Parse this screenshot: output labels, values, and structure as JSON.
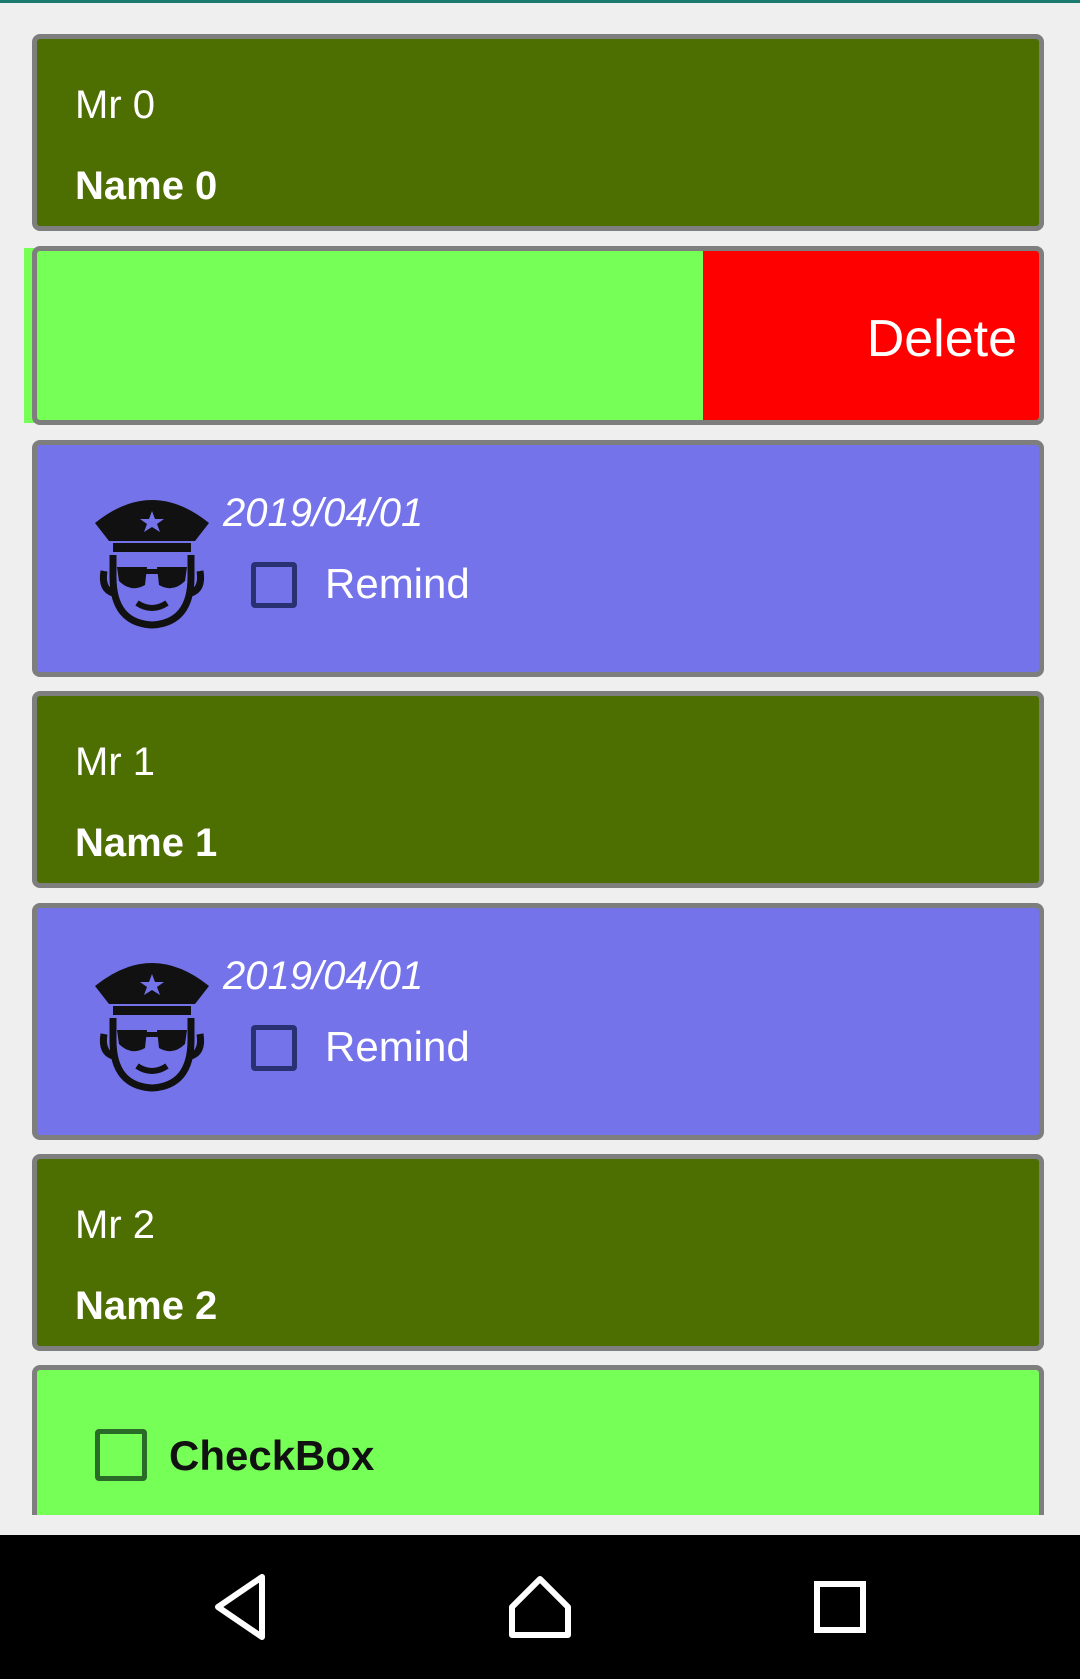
{
  "colors": {
    "olive_card": "#4d6e00",
    "swipe_card": "#76ff56",
    "delete_bg": "#ff0000",
    "purple_card": "#7573ea",
    "card_border": "#7e7e7e",
    "nav_bg": "#000000"
  },
  "items": [
    {
      "type": "person",
      "title": "Mr  0",
      "name": "Name 0"
    },
    {
      "type": "swipe",
      "action_label": "Delete"
    },
    {
      "type": "reminder",
      "icon": "police-officer-icon",
      "date": "2019/04/01",
      "checkbox_label": "Remind",
      "checked": false
    },
    {
      "type": "person",
      "title": "Mr  1",
      "name": "Name 1"
    },
    {
      "type": "reminder",
      "icon": "police-officer-icon",
      "date": "2019/04/01",
      "checkbox_label": "Remind",
      "checked": false
    },
    {
      "type": "person",
      "title": "Mr  2",
      "name": "Name 2"
    },
    {
      "type": "checkbox",
      "label": "CheckBox",
      "checked": false
    }
  ],
  "navbar": {
    "icons": [
      "back-icon",
      "home-icon",
      "recents-icon"
    ]
  }
}
